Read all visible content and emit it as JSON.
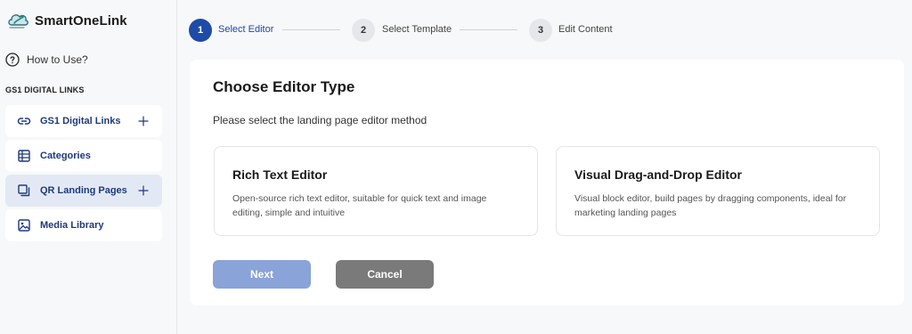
{
  "app": {
    "name": "SmartOneLink"
  },
  "sidebar": {
    "howto_label": "How to Use?",
    "section_title": "GS1 DIGITAL LINKS",
    "items": [
      {
        "label": "GS1 Digital Links",
        "icon": "link-icon",
        "has_add": true
      },
      {
        "label": "Categories",
        "icon": "table-icon",
        "has_add": false
      },
      {
        "label": "QR Landing Pages",
        "icon": "layers-icon",
        "has_add": true,
        "active": true
      },
      {
        "label": "Media Library",
        "icon": "image-icon",
        "has_add": false
      }
    ]
  },
  "stepper": {
    "steps": [
      {
        "number": "1",
        "label": "Select Editor",
        "state": "active"
      },
      {
        "number": "2",
        "label": "Select Template",
        "state": "todo"
      },
      {
        "number": "3",
        "label": "Edit Content",
        "state": "todo"
      }
    ]
  },
  "main": {
    "title": "Choose Editor Type",
    "subtitle": "Please select the landing page editor method",
    "options": [
      {
        "title": "Rich Text Editor",
        "description": "Open-source rich text editor, suitable for quick text and image editing, simple and intuitive"
      },
      {
        "title": "Visual Drag-and-Drop Editor",
        "description": "Visual block editor, build pages by dragging components, ideal for marketing landing pages"
      }
    ],
    "next_label": "Next",
    "cancel_label": "Cancel"
  },
  "colors": {
    "accent": "#1e4aa8",
    "nav_text": "#1e3a7b",
    "next_button": "#8aa3d8",
    "cancel_button": "#7a7a7a",
    "active_nav_bg": "#e3e9f4"
  }
}
